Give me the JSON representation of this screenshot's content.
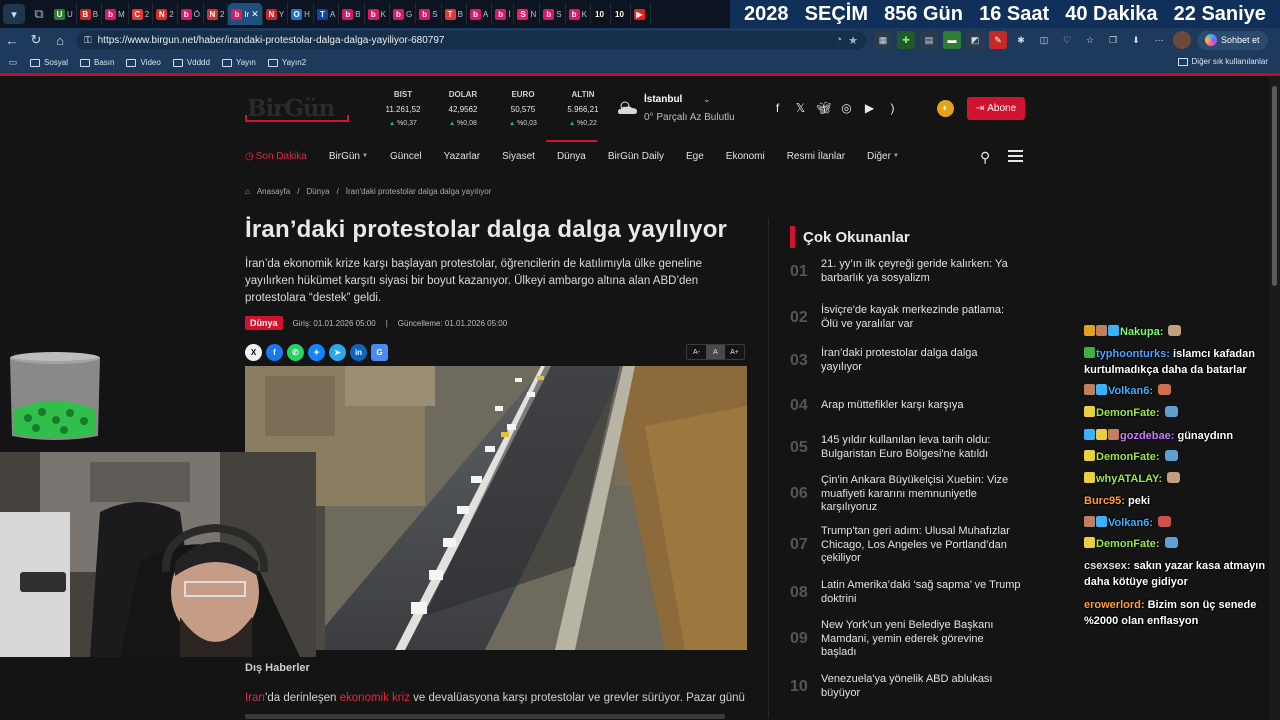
{
  "browser": {
    "tabs": [
      {
        "fav": "U",
        "color": "#2e7d32",
        "label": "U"
      },
      {
        "fav": "B",
        "color": "#c62828",
        "label": "B"
      },
      {
        "fav": "b",
        "color": "#d81b60",
        "label": "M"
      },
      {
        "fav": "C",
        "color": "#e53935",
        "label": "2"
      },
      {
        "fav": "N",
        "color": "#d32f2f",
        "label": "2"
      },
      {
        "fav": "b",
        "color": "#d81b60",
        "label": "Ö"
      },
      {
        "fav": "N",
        "color": "#d32f2f",
        "label": "2"
      },
      {
        "fav": "N",
        "color": "#c62828",
        "label": "Y"
      },
      {
        "fav": "O",
        "color": "#1976d2",
        "label": "H"
      },
      {
        "fav": "T",
        "color": "#0d47a1",
        "label": "A"
      },
      {
        "fav": "b",
        "color": "#d81b60",
        "label": "B"
      },
      {
        "fav": "b",
        "color": "#d81b60",
        "label": "K"
      },
      {
        "fav": "b",
        "color": "#d81b60",
        "label": "G"
      },
      {
        "fav": "b",
        "color": "#d81b60",
        "label": "S"
      },
      {
        "fav": "T",
        "color": "#e53935",
        "label": "B"
      },
      {
        "fav": "b",
        "color": "#d81b60",
        "label": "A"
      },
      {
        "fav": "b",
        "color": "#d81b60",
        "label": "İ"
      },
      {
        "fav": "S",
        "color": "#e91e63",
        "label": "N"
      },
      {
        "fav": "b",
        "color": "#d81b60",
        "label": "S"
      },
      {
        "fav": "b",
        "color": "#d81b60",
        "label": "K"
      },
      {
        "fav": "10",
        "color": "#111111",
        "label": ""
      },
      {
        "fav": "10",
        "color": "#111111",
        "label": ""
      },
      {
        "fav": "▶",
        "color": "#e62117",
        "label": ""
      }
    ],
    "active_tab": {
      "fav": "b",
      "color": "#d81b60",
      "label": "Ir"
    },
    "countdown": [
      "2028",
      "SEÇİM",
      "856 Gün",
      "16 Saat",
      "40 Dakika",
      "22 Saniye"
    ],
    "url": "https://www.birgun.net/haber/irandaki-protestolar-dalga-dalga-yayiliyor-680797",
    "copilot_label": "Sohbet et",
    "bookmarks": [
      "Sosyal",
      "Basın",
      "Video",
      "Vdddd",
      "Yayın",
      "Yayın2"
    ],
    "other_bookmarks": "Diğer sık kullanılanlar"
  },
  "site": {
    "logo": "BirGün",
    "markets": [
      {
        "name": "BIST",
        "value": "11.261,52",
        "change": "%0,37"
      },
      {
        "name": "DOLAR",
        "value": "42,9562",
        "change": "%0,08"
      },
      {
        "name": "EURO",
        "value": "50,575",
        "change": "%0,03"
      },
      {
        "name": "ALTIN",
        "value": "5.966,21",
        "change": "%0,22"
      }
    ],
    "weather": {
      "city": "İstanbul",
      "desc": "0° Parçalı Az Bulutlu"
    },
    "subscribe_label": "Abone",
    "nav": [
      {
        "label": "Son Dakika",
        "style": "red"
      },
      {
        "label": "BirGün",
        "caret": true
      },
      {
        "label": "Güncel"
      },
      {
        "label": "Yazarlar"
      },
      {
        "label": "Siyaset"
      },
      {
        "label": "Dünya",
        "style": "active"
      },
      {
        "label": "BirGün Daily"
      },
      {
        "label": "Ege"
      },
      {
        "label": "Ekonomi"
      },
      {
        "label": "Resmi İlanlar"
      },
      {
        "label": "Diğer",
        "caret": true
      }
    ]
  },
  "article": {
    "breadcrumb": [
      "Anasayfa",
      "Dünya",
      "İran'daki protestolar dalga dalga yayılıyor"
    ],
    "title": "İran’daki protestolar dalga dalga yayılıyor",
    "spot": "İran’da ekonomik krize karşı başlayan protestolar, öğrencilerin de katılımıyla ülke geneline yayılırken hükümet karşıtı siyasi bir boyut kazanıyor. Ülkeyi ambargo altına alan ABD’den protestolara “destek” geldi.",
    "category": "Dünya",
    "published": "Giriş: 01.01.2026 05:00",
    "separator": "|",
    "updated": "Güncelleme: 01.01.2026 05:00",
    "font_controls": [
      "A-",
      "A",
      "A+"
    ],
    "photo_caption": "Dış Haberler",
    "body_link1": "İran",
    "body_text1": "’da derinleşen ",
    "body_link2": "ekonomik kriz",
    "body_text2": " ve devalüasyona karşı protestolar ve grevler sürüyor. Pazar günü,"
  },
  "popular": {
    "title": "Çok Okunanlar",
    "items": [
      {
        "num": "01",
        "text": "21. yy’ın ilk çeyreği geride kalırken: Ya barbarlık ya sosyalizm"
      },
      {
        "num": "02",
        "text": "İsviçre'de kayak merkezinde patlama: Ölü ve yaralılar var"
      },
      {
        "num": "03",
        "text": "İran’daki protestolar dalga dalga yayılıyor"
      },
      {
        "num": "04",
        "text": "Arap müttefikler karşı karşıya"
      },
      {
        "num": "05",
        "text": "145 yıldır kullanılan leva tarih oldu: Bulgaristan Euro Bölgesi'ne katıldı"
      },
      {
        "num": "06",
        "text": "Çin'in Ankara Büyükelçisi Xuebin: Vize muafiyeti kararını memnuniyetle karşılıyoruz"
      },
      {
        "num": "07",
        "text": "Trump'tan geri adım: Ulusal Muhafızlar Chicago, Los Angeles ve Portland’dan çekiliyor"
      },
      {
        "num": "08",
        "text": "Latin Amerika’daki ‘sağ sapma’ ve Trump doktrini"
      },
      {
        "num": "09",
        "text": "New York’un yeni Belediye Başkanı Mamdani, yemin ederek görevine başladı"
      },
      {
        "num": "10",
        "text": "Venezuela'ya yönelik ABD ablukası büyüyor"
      }
    ]
  },
  "chat": [
    {
      "user": "Nakupa:",
      "color": "#7cff6b",
      "text": "",
      "badges": [
        "#e0a020",
        "#c08060",
        "#3ab0ff"
      ],
      "emote": "#c0a080"
    },
    {
      "user": "typhoonturks:",
      "color": "#4aa3ff",
      "text": "islamcı kafadan kurtulmadıkça daha da batarlar",
      "badges": [
        "#3cb043"
      ]
    },
    {
      "user": "Volkan6:",
      "color": "#3ab0ff",
      "text": "",
      "badges": [
        "#c08060",
        "#3ab0ff"
      ],
      "emote": "#d07050"
    },
    {
      "user": "DemonFate:",
      "color": "#9be84a",
      "text": "",
      "badges": [
        "#e8d040"
      ],
      "emote": "#60a0d0"
    },
    {
      "user": "gozdebae:",
      "color": "#c77dff",
      "text": "günaydınn",
      "badges": [
        "#3ab0ff",
        "#e8d040",
        "#c08060"
      ]
    },
    {
      "user": "DemonFate:",
      "color": "#9be84a",
      "text": "",
      "badges": [
        "#e8d040"
      ],
      "emote": "#60a0d0"
    },
    {
      "user": "whyATALAY:",
      "color": "#9be84a",
      "text": "",
      "badges": [
        "#e8d040"
      ],
      "emote": "#c0a080"
    },
    {
      "user": "Burc95:",
      "color": "#ff9f3a",
      "text": "peki",
      "badges": []
    },
    {
      "user": "Volkan6:",
      "color": "#3ab0ff",
      "text": "",
      "badges": [
        "#c08060",
        "#3ab0ff"
      ],
      "emote": "#d05050"
    },
    {
      "user": "DemonFate:",
      "color": "#9be84a",
      "text": "",
      "badges": [
        "#e8d040"
      ],
      "emote": "#60a0d0"
    },
    {
      "user": "csexsex:",
      "color": "#e0e0e0",
      "text": "sakın yazar kasa atmayın daha kötüye gidiyor",
      "badges": []
    },
    {
      "user": "erowerlord:",
      "color": "#ff9f3a",
      "text": "Bizim son üç senede %2000 olan enflasyon",
      "badges": []
    }
  ]
}
